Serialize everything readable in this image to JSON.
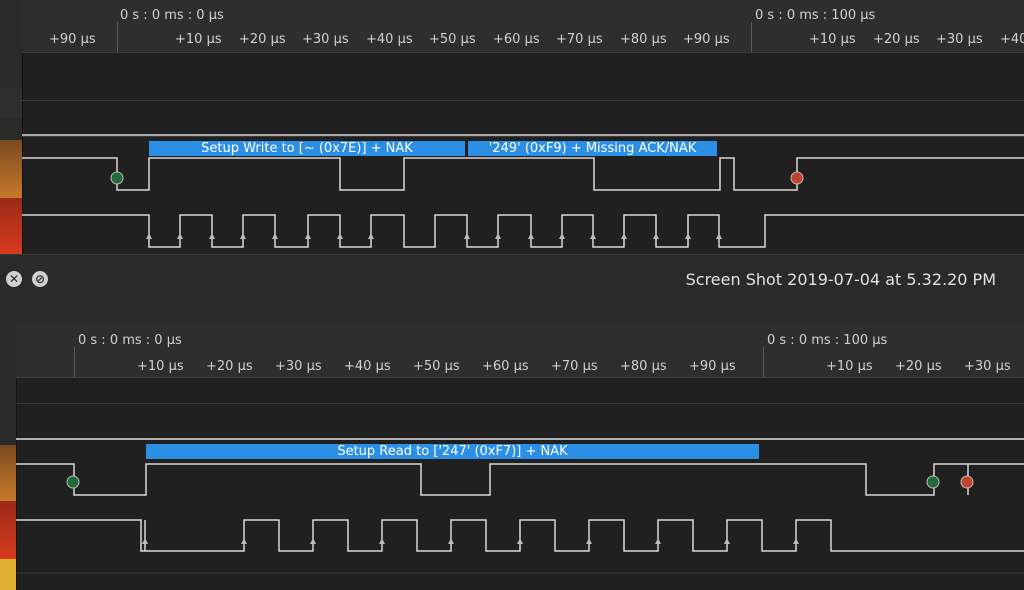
{
  "top_panel": {
    "timeline": {
      "abs_left": "0 s : 0 ms : 0 µs",
      "abs_right": "0 s : 0 ms : 100 µs",
      "ticks": [
        "+90 µs",
        "+10 µs",
        "+20 µs",
        "+30 µs",
        "+40 µs",
        "+50 µs",
        "+60 µs",
        "+70 µs",
        "+80 µs",
        "+90 µs",
        "+10 µs",
        "+20 µs",
        "+30 µs",
        "+40"
      ]
    },
    "protocol": [
      {
        "label": "Setup Write to [~ (0x7E)] + NAK"
      },
      {
        "label": "'249' (0xF9) + Missing ACK/NAK"
      }
    ]
  },
  "footer": {
    "title": "Screen Shot 2019-07-04 at 5.32.20 PM",
    "close_icon": "x-circle-icon",
    "minimize_icon": "slash-circle-icon"
  },
  "bottom_panel": {
    "timeline": {
      "abs_left": "0 s : 0 ms : 0 µs",
      "abs_right": "0 s : 0 ms : 100 µs",
      "ticks": [
        "+10 µs",
        "+20 µs",
        "+30 µs",
        "+40 µs",
        "+50 µs",
        "+60 µs",
        "+70 µs",
        "+80 µs",
        "+90 µs",
        "+10 µs",
        "+20 µs",
        "+30 µs"
      ]
    },
    "protocol": [
      {
        "label": "Setup Read to ['247' (0xF7)] + NAK"
      }
    ]
  },
  "colors": {
    "protocol_bar": "#2c8fe6",
    "start_marker": "#1f6b3a",
    "stop_marker": "#c0432a",
    "channel_orange": "#c7792a",
    "channel_red": "#d83a1f",
    "channel_yellow": "#e0b030"
  }
}
